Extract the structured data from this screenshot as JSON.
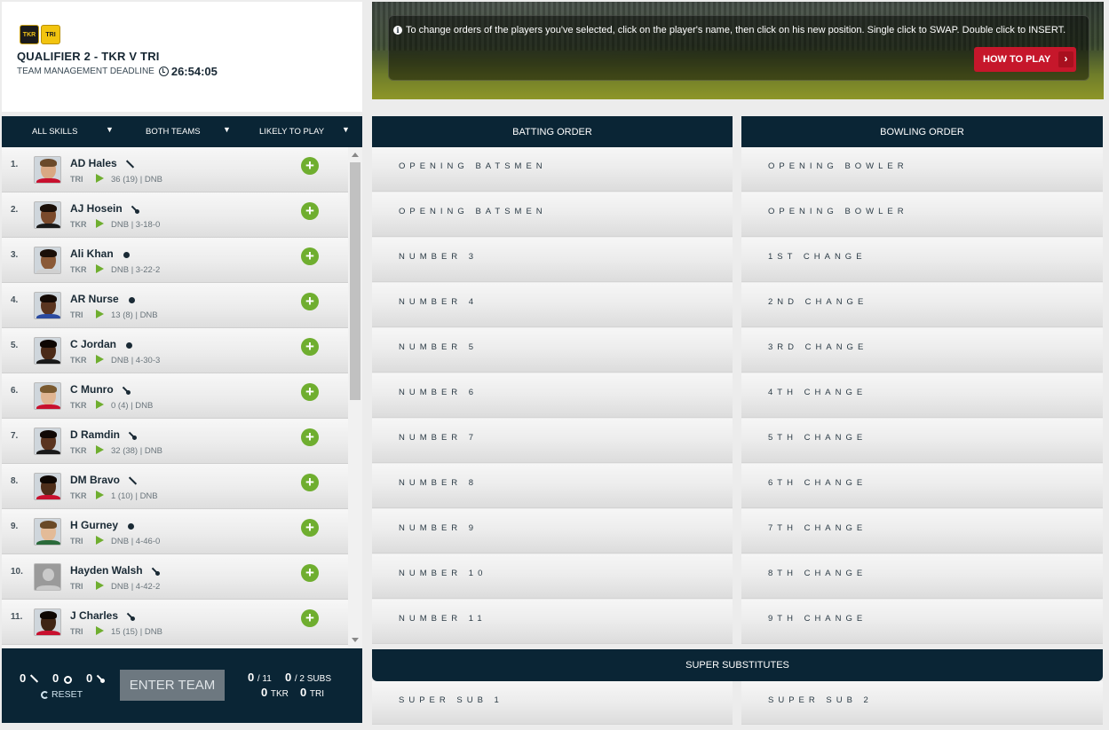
{
  "match": {
    "team_badges": [
      "TKR",
      "TRI"
    ],
    "title": "QUALIFIER 2 - TKR V TRI",
    "deadline_label": "TEAM MANAGEMENT DEADLINE",
    "deadline_time": "26:54:05"
  },
  "banner": {
    "info_text": "To change orders of the players you've selected, click on the player's name, then click on his new position. Single click to SWAP. Double click to INSERT.",
    "how_to_play": "HOW TO PLAY",
    "how_to_play_chevron": "›"
  },
  "filters": {
    "skills": "ALL SKILLS",
    "teams": "BOTH TEAMS",
    "likely": "LIKELY TO PLAY",
    "caret": "▼"
  },
  "players": [
    {
      "num": "1.",
      "name": "AD Hales",
      "skill": "bat",
      "team": "TRI",
      "stats": "36 (19) | DNB"
    },
    {
      "num": "2.",
      "name": "AJ Hosein",
      "skill": "all",
      "team": "TKR",
      "stats": "DNB | 3-18-0"
    },
    {
      "num": "3.",
      "name": "Ali Khan",
      "skill": "bowl",
      "team": "TKR",
      "stats": "DNB | 3-22-2"
    },
    {
      "num": "4.",
      "name": "AR Nurse",
      "skill": "bowl",
      "team": "TRI",
      "stats": "13 (8) | DNB"
    },
    {
      "num": "5.",
      "name": "C Jordan",
      "skill": "bowl",
      "team": "TKR",
      "stats": "DNB | 4-30-3"
    },
    {
      "num": "6.",
      "name": "C Munro",
      "skill": "all",
      "team": "TKR",
      "stats": "0 (4) | DNB"
    },
    {
      "num": "7.",
      "name": "D Ramdin",
      "skill": "all",
      "team": "TKR",
      "stats": "32 (38) | DNB"
    },
    {
      "num": "8.",
      "name": "DM Bravo",
      "skill": "bat",
      "team": "TKR",
      "stats": "1 (10) | DNB"
    },
    {
      "num": "9.",
      "name": "H Gurney",
      "skill": "bowl",
      "team": "TRI",
      "stats": "DNB | 4-46-0"
    },
    {
      "num": "10.",
      "name": "Hayden Walsh",
      "skill": "all",
      "team": "TRI",
      "stats": "DNB | 4-42-2"
    },
    {
      "num": "11.",
      "name": "J Charles",
      "skill": "all",
      "team": "TRI",
      "stats": "15 (15) | DNB"
    }
  ],
  "add_symbol": "+",
  "footer": {
    "bat_count": "0",
    "bowl_count": "0",
    "all_count": "0",
    "reset": "RESET",
    "enter_team": "ENTER TEAM",
    "selected": "0",
    "selected_total": "/ 11",
    "subs": "0",
    "subs_total": "/ 2 SUBS",
    "tkr_count": "0",
    "tkr_label": "TKR",
    "tri_count": "0",
    "tri_label": "TRI"
  },
  "batting": {
    "header": "BATTING ORDER",
    "slots": [
      "OPENING BATSMEN",
      "OPENING BATSMEN",
      "NUMBER 3",
      "NUMBER 4",
      "NUMBER 5",
      "NUMBER 6",
      "NUMBER 7",
      "NUMBER 8",
      "NUMBER 9",
      "NUMBER 10",
      "NUMBER 11"
    ]
  },
  "bowling": {
    "header": "BOWLING ORDER",
    "slots": [
      "OPENING BOWLER",
      "OPENING BOWLER",
      "1ST CHANGE",
      "2ND CHANGE",
      "3RD CHANGE",
      "4TH CHANGE",
      "5TH CHANGE",
      "6TH CHANGE",
      "7TH CHANGE",
      "8TH CHANGE",
      "9TH CHANGE"
    ]
  },
  "super_subs": {
    "header": "SUPER SUBSTITUTES",
    "slots": [
      "SUPER SUB 1",
      "SUPER SUB 2"
    ]
  },
  "colors": {
    "navy": "#0a2535",
    "green": "#6fae2f",
    "red": "#c6172b"
  }
}
